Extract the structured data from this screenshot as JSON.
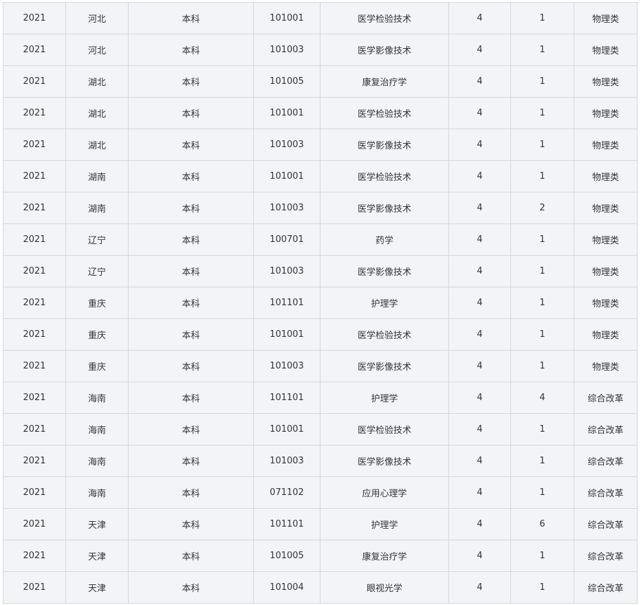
{
  "table": {
    "rows": [
      [
        "2021",
        "河北",
        "本科",
        "101001",
        "医学检验技术",
        "4",
        "1",
        "物理类"
      ],
      [
        "2021",
        "河北",
        "本科",
        "101003",
        "医学影像技术",
        "4",
        "1",
        "物理类"
      ],
      [
        "2021",
        "湖北",
        "本科",
        "101005",
        "康复治疗学",
        "4",
        "1",
        "物理类"
      ],
      [
        "2021",
        "湖北",
        "本科",
        "101001",
        "医学检验技术",
        "4",
        "1",
        "物理类"
      ],
      [
        "2021",
        "湖北",
        "本科",
        "101003",
        "医学影像技术",
        "4",
        "1",
        "物理类"
      ],
      [
        "2021",
        "湖南",
        "本科",
        "101001",
        "医学检验技术",
        "4",
        "1",
        "物理类"
      ],
      [
        "2021",
        "湖南",
        "本科",
        "101003",
        "医学影像技术",
        "4",
        "2",
        "物理类"
      ],
      [
        "2021",
        "辽宁",
        "本科",
        "100701",
        "药学",
        "4",
        "1",
        "物理类"
      ],
      [
        "2021",
        "辽宁",
        "本科",
        "101003",
        "医学影像技术",
        "4",
        "1",
        "物理类"
      ],
      [
        "2021",
        "重庆",
        "本科",
        "101101",
        "护理学",
        "4",
        "1",
        "物理类"
      ],
      [
        "2021",
        "重庆",
        "本科",
        "101001",
        "医学检验技术",
        "4",
        "1",
        "物理类"
      ],
      [
        "2021",
        "重庆",
        "本科",
        "101003",
        "医学影像技术",
        "4",
        "1",
        "物理类"
      ],
      [
        "2021",
        "海南",
        "本科",
        "101101",
        "护理学",
        "4",
        "4",
        "综合改革"
      ],
      [
        "2021",
        "海南",
        "本科",
        "101001",
        "医学检验技术",
        "4",
        "1",
        "综合改革"
      ],
      [
        "2021",
        "海南",
        "本科",
        "101003",
        "医学影像技术",
        "4",
        "1",
        "综合改革"
      ],
      [
        "2021",
        "海南",
        "本科",
        "071102",
        "应用心理学",
        "4",
        "1",
        "综合改革"
      ],
      [
        "2021",
        "天津",
        "本科",
        "101101",
        "护理学",
        "4",
        "6",
        "综合改革"
      ],
      [
        "2021",
        "天津",
        "本科",
        "101005",
        "康复治疗学",
        "4",
        "1",
        "综合改革"
      ],
      [
        "2021",
        "天津",
        "本科",
        "101004",
        "眼视光学",
        "4",
        "1",
        "综合改革"
      ]
    ]
  },
  "colors": {
    "cell_background": "#f3f4f8",
    "border": "#d3d6de",
    "text": "#333333"
  }
}
